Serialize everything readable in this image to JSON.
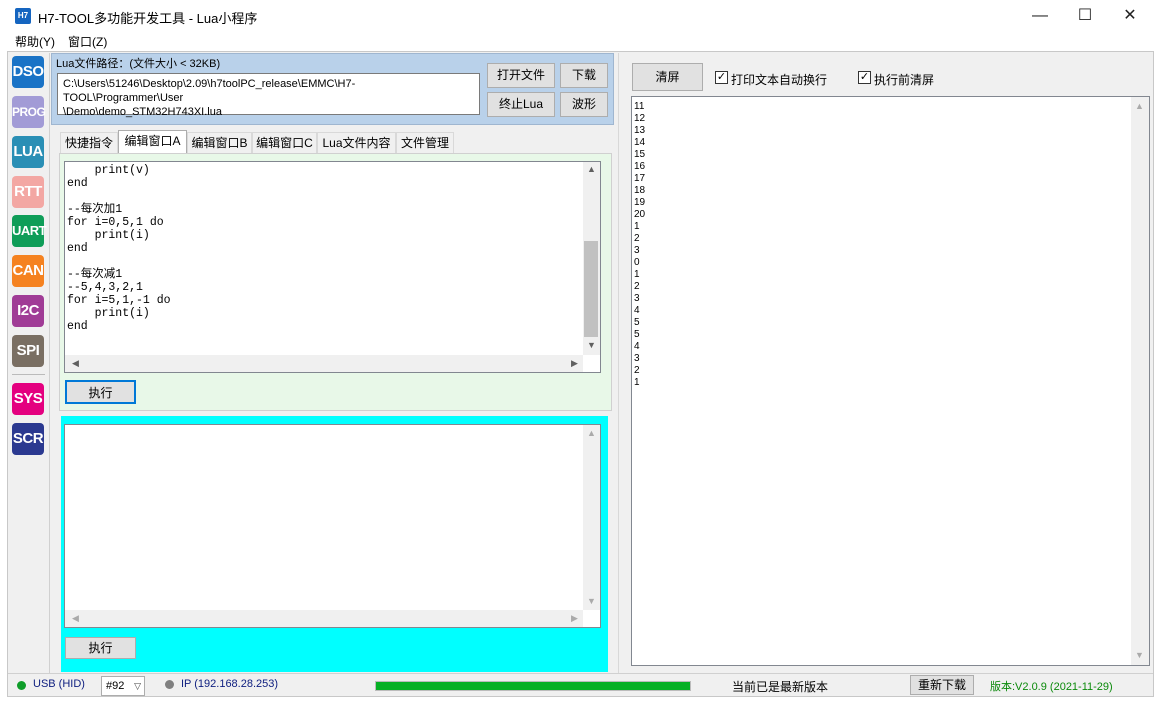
{
  "window": {
    "icon_text": "H7",
    "title": "H7-TOOL多功能开发工具 - Lua小程序",
    "controls": [
      "—",
      "☐",
      "✕"
    ]
  },
  "menu": [
    "帮助(Y)",
    "窗口(Z)"
  ],
  "tools": [
    {
      "label": "DSO",
      "color": "#1a73c6"
    },
    {
      "label": "PROG",
      "color": "#a29bd6"
    },
    {
      "label": "LUA",
      "color": "#2a8fb5"
    },
    {
      "label": "RTT",
      "color": "#f3a7a3"
    },
    {
      "label": "UART",
      "color": "#0f9d58"
    },
    {
      "label": "CAN",
      "color": "#f58220"
    },
    {
      "label": "I2C",
      "color": "#a03c96"
    },
    {
      "label": "SPI",
      "color": "#7a6f63"
    },
    {
      "label": "SYS",
      "color": "#e4007f"
    },
    {
      "label": "SCR",
      "color": "#2b3990"
    }
  ],
  "file": {
    "label": "Lua文件路径：(文件大小 < 32KB)",
    "path_line1": "C:\\Users\\51246\\Desktop\\2.09\\h7toolPC_release\\EMMC\\H7-TOOL\\Programmer\\User",
    "path_line2": "\\Demo\\demo_STM32H743XI.lua",
    "open_label": "打开文件",
    "download_label": "下载",
    "stop_label": "终止Lua",
    "wave_label": "波形"
  },
  "tabs": [
    "快捷指令",
    "编辑窗口A",
    "编辑窗口B",
    "编辑窗口C",
    "Lua文件内容",
    "文件管理"
  ],
  "active_tab": 1,
  "editor": {
    "code": "    print(v)\nend\n\n--每次加1\nfor i=0,5,1 do\n    print(i)\nend\n\n--每次减1\n--5,4,3,2,1\nfor i=5,1,-1 do\n    print(i)\nend",
    "run_label": "执行"
  },
  "command": {
    "run_label": "执行"
  },
  "output_panel": {
    "clear_label": "清屏",
    "wrap_label": "打印文本自动换行",
    "wrap_checked": true,
    "clear_before_label": "执行前清屏",
    "clear_before_checked": true,
    "text": "11\n12\n13\n14\n15\n16\n17\n18\n19\n20\n1\n2\n3\n0\n1\n2\n3\n4\n5\n5\n4\n3\n2\n1"
  },
  "status": {
    "usb_label": "USB (HID)",
    "usb_color": "#0f9d2a",
    "device_select": "#92",
    "ip_label": "IP (192.168.28.253)",
    "ip_color": "#808080",
    "progress": 1.0,
    "progress_color": "#06b025",
    "version_status": "当前已是最新版本",
    "redownload_label": "重新下载",
    "version": "版本:V2.0.9 (2021-11-29)",
    "version_color": "#0a8a0a"
  }
}
